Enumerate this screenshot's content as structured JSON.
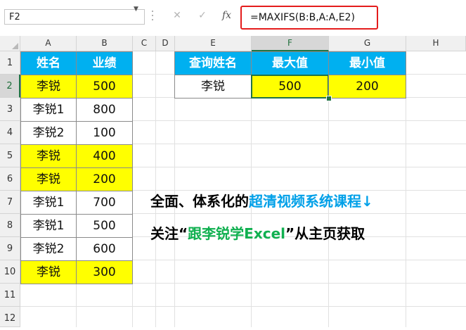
{
  "formula_bar": {
    "name_box": "F2",
    "cancel_symbol": "✕",
    "enter_symbol": "✓",
    "fx_label": "fx",
    "formula": "=MAXIFS(B:B,A:A,E2)"
  },
  "columns": [
    "A",
    "B",
    "C",
    "D",
    "E",
    "F",
    "G",
    "H"
  ],
  "rows": [
    "1",
    "2",
    "3",
    "4",
    "5",
    "6",
    "7",
    "8",
    "9",
    "10",
    "11",
    "12"
  ],
  "source_table": {
    "headers": [
      "姓名",
      "业绩"
    ],
    "rows": [
      {
        "name": "李锐",
        "value": "500"
      },
      {
        "name": "李锐1",
        "value": "800"
      },
      {
        "name": "李锐2",
        "value": "100"
      },
      {
        "name": "李锐",
        "value": "400"
      },
      {
        "name": "李锐",
        "value": "200"
      },
      {
        "name": "李锐1",
        "value": "700"
      },
      {
        "name": "李锐1",
        "value": "500"
      },
      {
        "name": "李锐2",
        "value": "600"
      },
      {
        "name": "李锐",
        "value": "300"
      }
    ]
  },
  "query_table": {
    "headers": [
      "查询姓名",
      "最大值",
      "最小值"
    ],
    "name": "李锐",
    "max": "500",
    "min": "200"
  },
  "promo": {
    "line1_black": "全面、体系化的",
    "line1_blue": "超清视频系统课程↓",
    "line2_black_a": "关注“",
    "line2_green": "跟李锐学Excel",
    "line2_black_b": "”从主页获取"
  },
  "colors": {
    "header_fill": "#00b0f0",
    "highlight_fill": "#ffff00",
    "formula_highlight": "#e41c1c",
    "promo_blue": "#00a0e8",
    "promo_green": "#10b050"
  }
}
